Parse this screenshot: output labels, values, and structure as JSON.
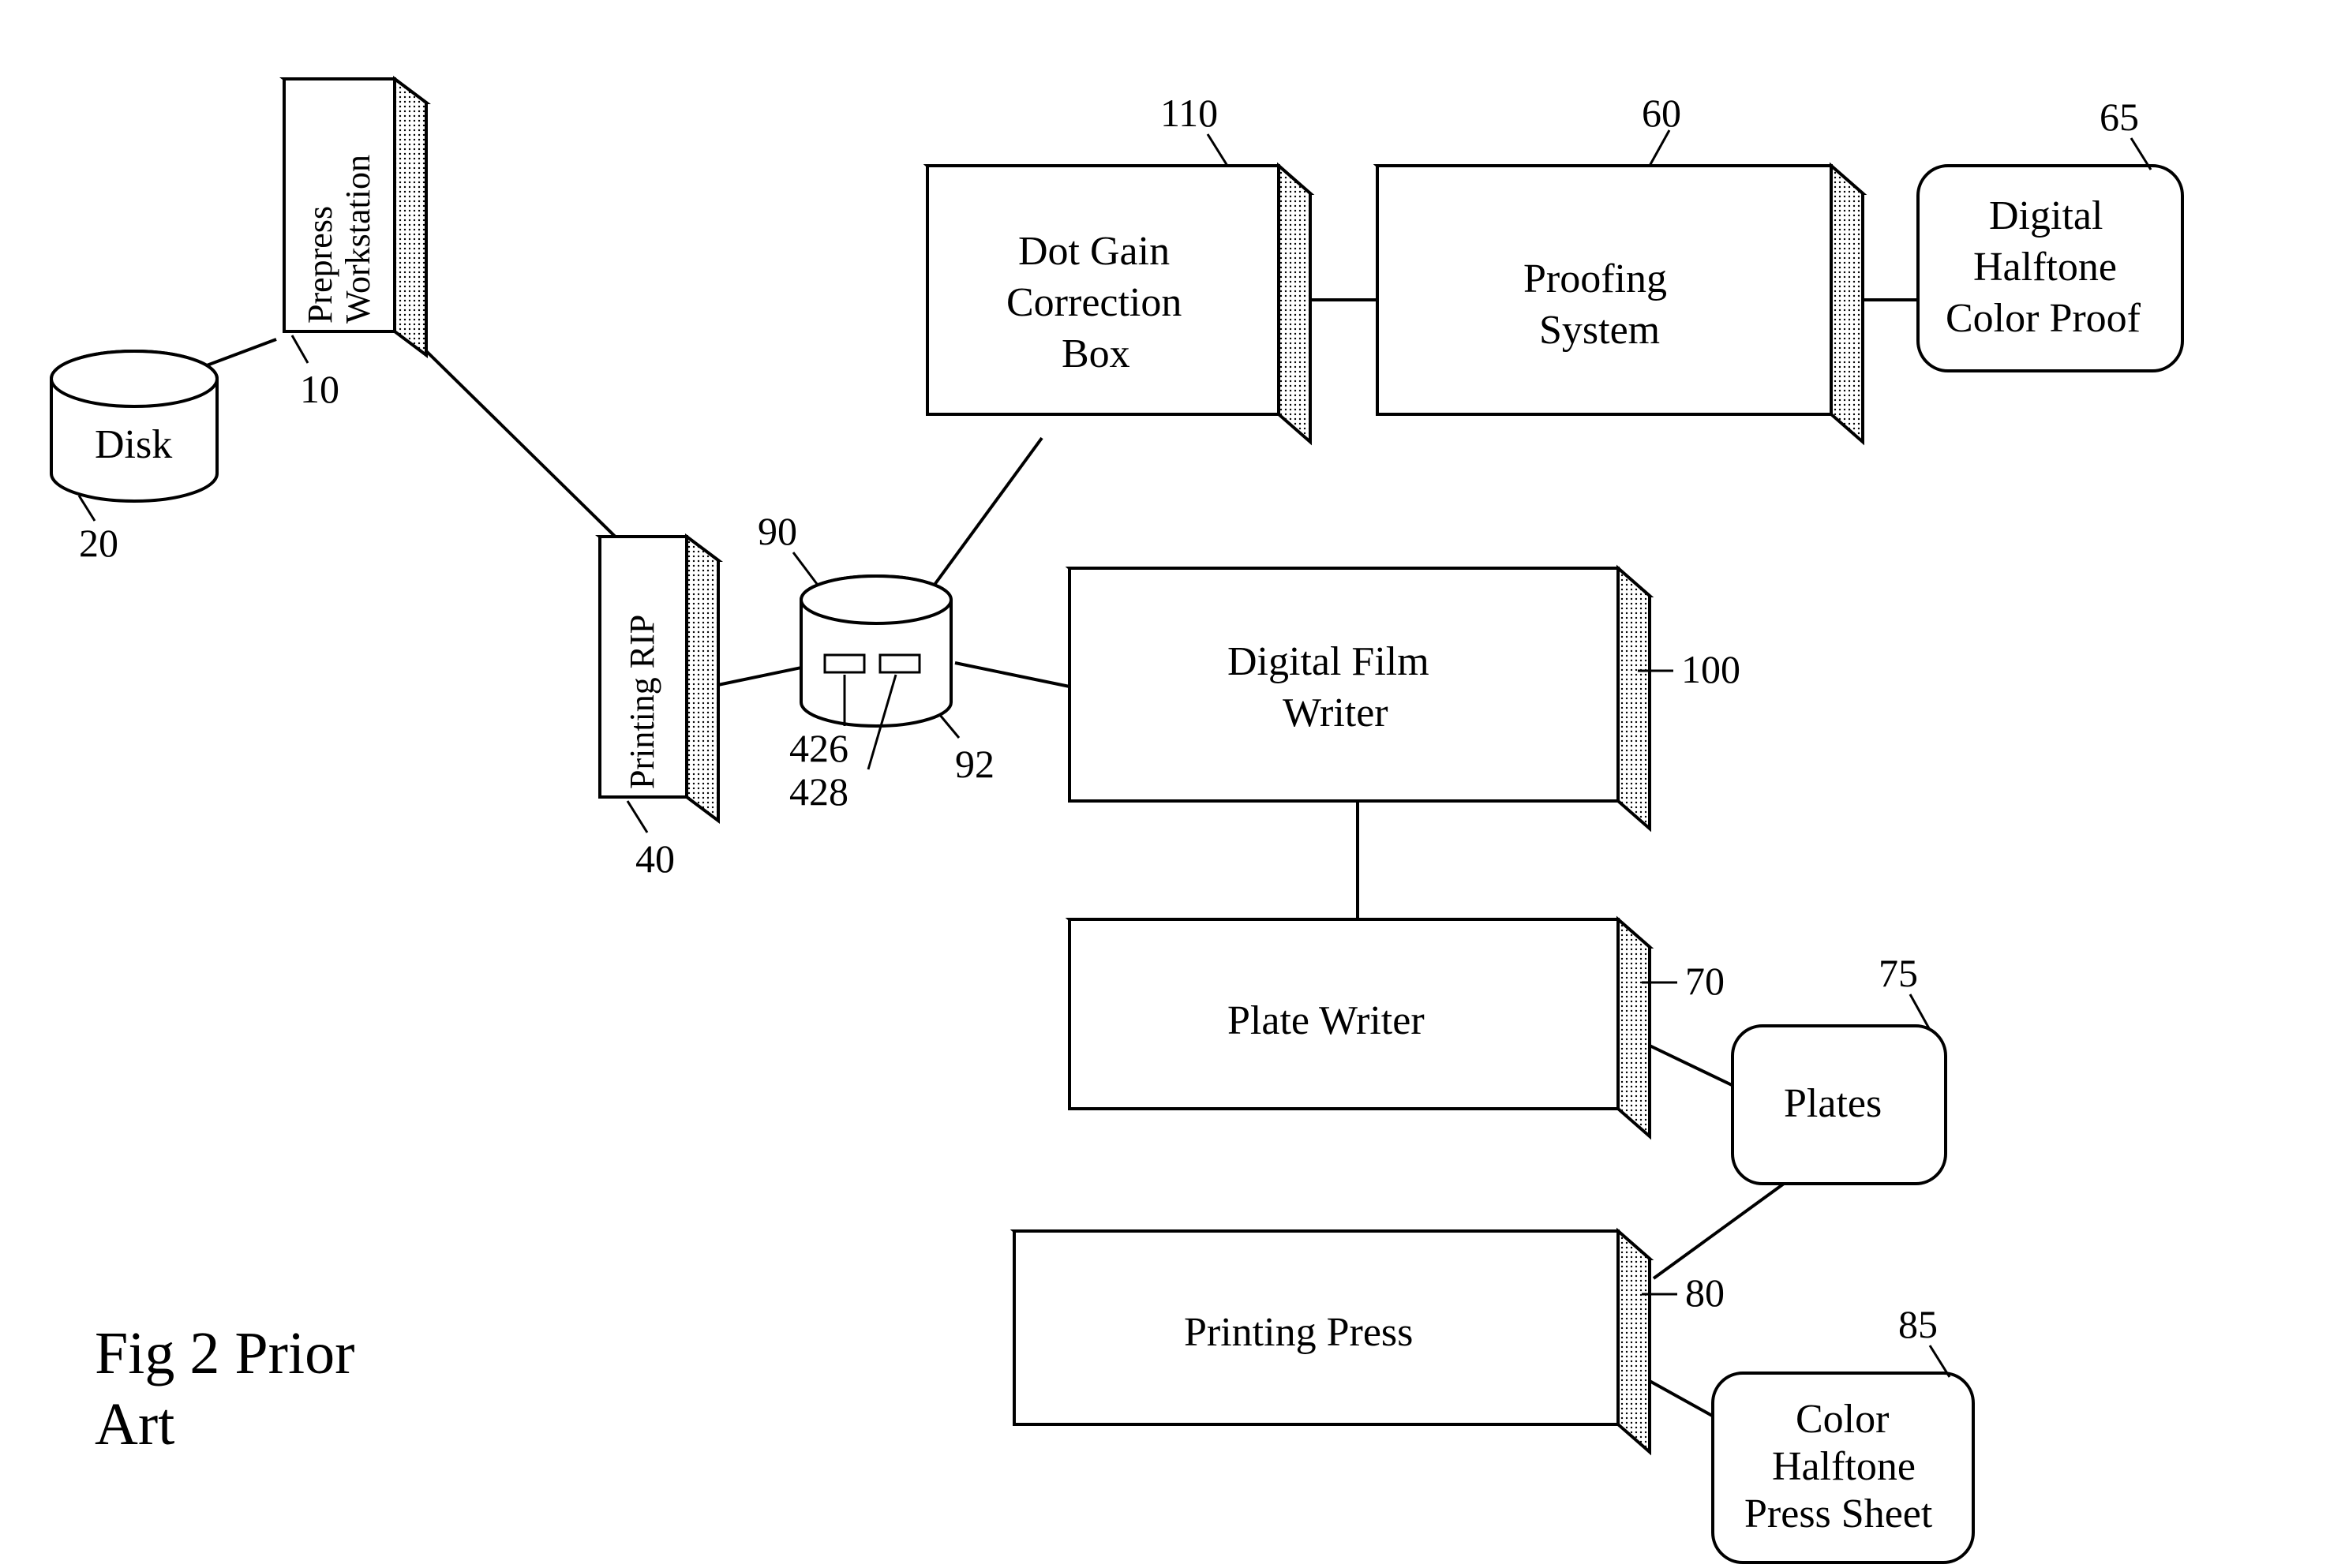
{
  "figure_title_line1": "Fig 2 Prior",
  "figure_title_line2": "Art",
  "nodes": {
    "prepress": {
      "label": "Prepress Workstation",
      "ref": "10"
    },
    "disk": {
      "label": "Disk",
      "ref": "20"
    },
    "rip": {
      "label": "Printing  RIP",
      "ref": "40"
    },
    "spool": {
      "ref_top": "90",
      "ref_right": "92",
      "ref_inner1": "426",
      "ref_inner2": "428"
    },
    "dotgain": {
      "line1": "Dot Gain",
      "line2": "Correction",
      "line3": "Box",
      "ref": "110"
    },
    "proofing": {
      "line1": "Proofing",
      "line2": "System",
      "ref": "60"
    },
    "proof": {
      "line1": "Digital",
      "line2": "Halftone",
      "line3": "Color Proof",
      "ref": "65"
    },
    "filmw": {
      "line1": "Digital Film",
      "line2": "Writer",
      "ref": "100"
    },
    "platew": {
      "label": "Plate Writer",
      "ref": "70"
    },
    "plates": {
      "label": "Plates",
      "ref": "75"
    },
    "press": {
      "label": "Printing Press",
      "ref": "80"
    },
    "sheet": {
      "line1": "Color",
      "line2": "Halftone",
      "line3": "Press Sheet",
      "ref": "85"
    }
  }
}
